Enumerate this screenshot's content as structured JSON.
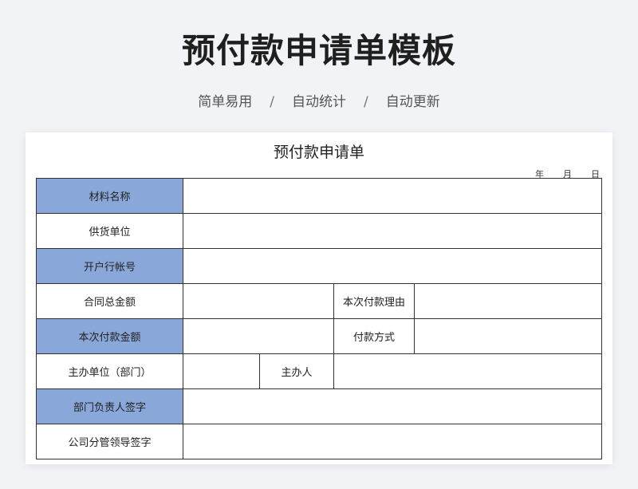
{
  "header": {
    "title": "预付款申请单模板",
    "tags": [
      "简单易用",
      "自动统计",
      "自动更新"
    ],
    "separator": "/"
  },
  "form": {
    "title": "预付款申请单",
    "date_labels": [
      "年",
      "月",
      "日"
    ],
    "rows": {
      "material_name": "材料名称",
      "supplier": "供货单位",
      "bank_account": "开户行帐号",
      "contract_total": "合同总金额",
      "payment_reason": "本次付款理由",
      "payment_amount": "本次付款金额",
      "payment_method": "付款方式",
      "host_unit": "主办单位（部门）",
      "host_person": "主办人",
      "dept_head_sign": "部门负责人签字",
      "company_leader_sign": "公司分管领导签字"
    }
  },
  "colors": {
    "label_highlight": "#8aa7d9",
    "background": "#f1f3f6"
  }
}
